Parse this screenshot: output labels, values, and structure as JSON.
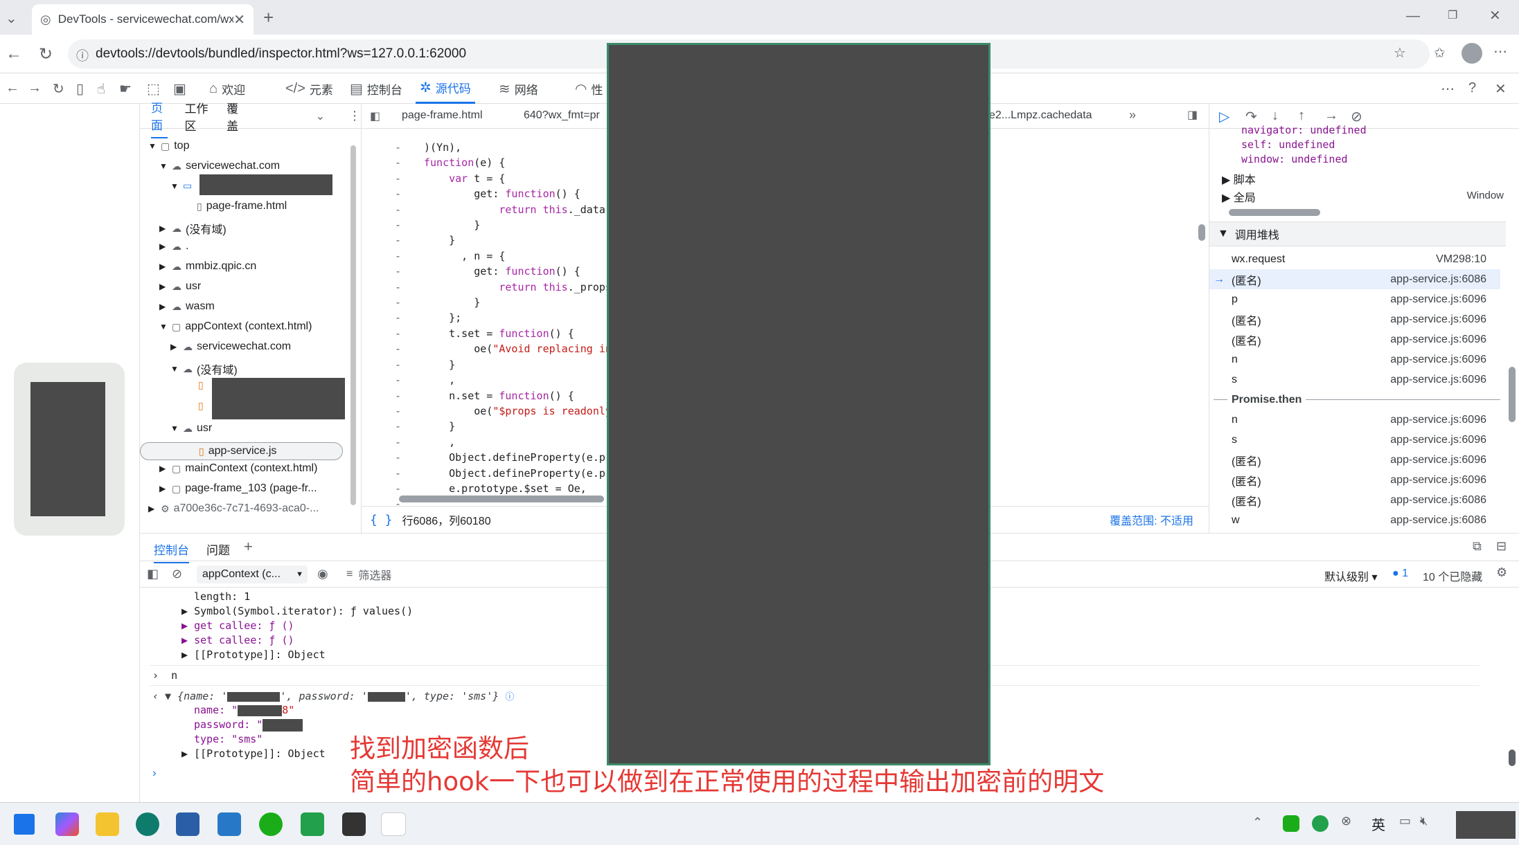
{
  "browser": {
    "tab_title": "DevTools - servicewechat.com/wx",
    "url": "devtools://devtools/bundled/inspector.html?ws=127.0.0.1:62000"
  },
  "devtools_tabs": [
    "欢迎",
    "元素",
    "控制台",
    "源代码",
    "网络",
    "性"
  ],
  "navigator": {
    "tabs": [
      "页面",
      "工作区",
      "覆盖"
    ],
    "tree": [
      {
        "label": "top"
      },
      {
        "label": "servicewechat.com"
      },
      {
        "label": "page-frame.html"
      },
      {
        "label": "(没有域)"
      },
      {
        "label": "."
      },
      {
        "label": "mmbiz.qpic.cn"
      },
      {
        "label": "usr"
      },
      {
        "label": "wasm"
      },
      {
        "label": "appContext (context.html)"
      },
      {
        "label": "servicewechat.com"
      },
      {
        "label": "(没有域)"
      },
      {
        "label": "usr"
      },
      {
        "label": "app-service.js"
      },
      {
        "label": "mainContext (context.html)"
      },
      {
        "label": "page-frame_103 (page-fr..."
      },
      {
        "label": "a700e36c-7c71-4693-aca0-..."
      }
    ]
  },
  "editor": {
    "tabs": [
      "page-frame.html",
      "640?wx_fmt=pr",
      "e2...Lmpz.cachedata"
    ],
    "status_position": "行6086，列60180",
    "status_coverage": "覆盖范围: 不适用",
    "gutter_mark": "-"
  },
  "debugger": {
    "scope_lines": [
      "navigator: undefined",
      "self: undefined",
      "window: undefined"
    ],
    "scope_sections": [
      "脚本",
      "全局"
    ],
    "global_value": "Window",
    "callstack_title": "调用堆栈",
    "frames_top": [
      {
        "fn": "wx.request",
        "loc": "VM298:10"
      },
      {
        "fn": "(匿名)",
        "loc": "app-service.js:6086"
      },
      {
        "fn": "p",
        "loc": "app-service.js:6096"
      },
      {
        "fn": "(匿名)",
        "loc": "app-service.js:6096"
      },
      {
        "fn": "(匿名)",
        "loc": "app-service.js:6096"
      },
      {
        "fn": "n",
        "loc": "app-service.js:6096"
      },
      {
        "fn": "s",
        "loc": "app-service.js:6096"
      }
    ],
    "async_label": "Promise.then",
    "frames_bottom": [
      {
        "fn": "n",
        "loc": "app-service.js:6096"
      },
      {
        "fn": "s",
        "loc": "app-service.js:6096"
      },
      {
        "fn": "(匿名)",
        "loc": "app-service.js:6096"
      },
      {
        "fn": "(匿名)",
        "loc": "app-service.js:6096"
      },
      {
        "fn": "(匿名)",
        "loc": "app-service.js:6086"
      },
      {
        "fn": "w",
        "loc": "app-service.js:6086"
      }
    ]
  },
  "console": {
    "tabs": [
      "控制台",
      "问题"
    ],
    "context_select": "appContext (c...",
    "filter_placeholder": "筛选器",
    "level": "默认级别",
    "issues_count": "1",
    "hidden": "10 个已隐藏",
    "lines": [
      "length: 1",
      "Symbol(Symbol.iterator): ƒ values()",
      "get callee: ƒ ()",
      "set callee: ƒ ()",
      "[[Prototype]]: Object",
      "n",
      "{name: '",
      "', password: '",
      "', type: 'sms'}",
      "name: \"",
      "8\"",
      "password: \"",
      "type: \"sms\"",
      "[[Prototype]]: Object"
    ]
  },
  "annotation": {
    "line1": "找到加密函数后",
    "line2": "简单的hook一下也可以做到在正常使用的过程中输出加密前的明文"
  },
  "taskbar": {
    "ime": "英"
  }
}
